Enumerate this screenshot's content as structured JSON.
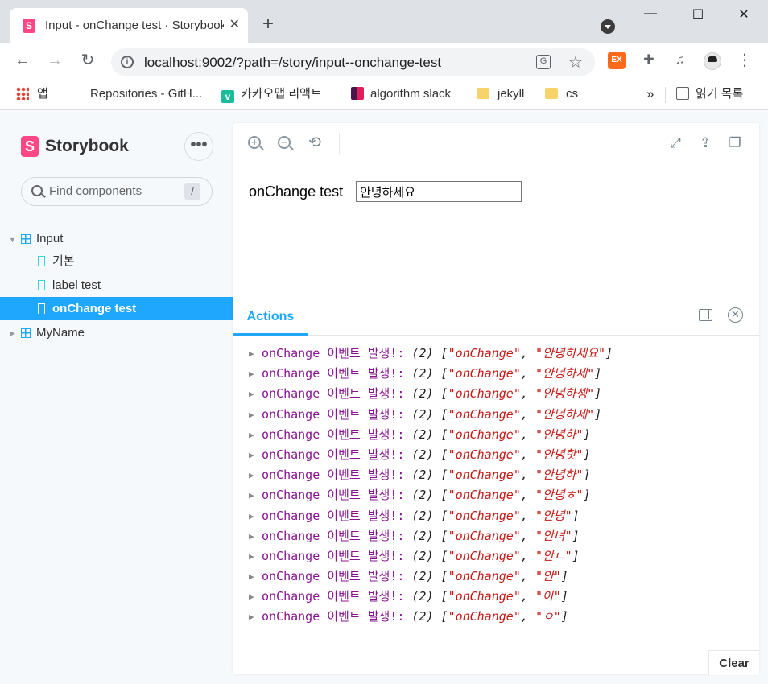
{
  "browser": {
    "tab_title": "Input - onChange test · Storybook",
    "new_tab": "+",
    "tab_close": "✕",
    "window": {
      "minimize": "—",
      "maximize": "☐",
      "close": "✕"
    },
    "url": "localhost:9002/?path=/story/input--onchange-test",
    "bookmarks": [
      {
        "label": "앱"
      },
      {
        "label": "Repositories - GitH..."
      },
      {
        "label": "카카오맵 리액트",
        "icon_letter": "v"
      },
      {
        "label": "algorithm slack"
      },
      {
        "label": "jekyll"
      },
      {
        "label": "cs"
      }
    ],
    "bookmarks_overflow": "»",
    "reading_list": "읽기 목록",
    "ext_badge": "EX"
  },
  "storybook": {
    "brand": "Storybook",
    "brand_logo_letter": "S",
    "menu_glyph": "•••",
    "search_placeholder": "Find components",
    "search_shortcut": "/",
    "tree": [
      {
        "type": "component",
        "label": "Input",
        "expanded": true
      },
      {
        "type": "story",
        "label": "기본"
      },
      {
        "type": "story",
        "label": "label test"
      },
      {
        "type": "story",
        "label": "onChange test",
        "selected": true
      },
      {
        "type": "component",
        "label": "MyName",
        "expanded": false
      }
    ],
    "preview": {
      "label": "onChange test",
      "input_value": "안녕하세요"
    },
    "addons": {
      "active_tab": "Actions",
      "clear_label": "Clear",
      "log_name": "onChange 이벤트 발생!:",
      "log_count": "(2)",
      "log_event": "\"onChange\"",
      "log_values": [
        "안녕하세요",
        "안녕하세",
        "안녕하셍",
        "안녕하세",
        "안녕하",
        "안녕핫",
        "안녕하",
        "안녕ㅎ",
        "안녕",
        "안녀",
        "안ㄴ",
        "안",
        "아",
        "ㅇ"
      ]
    }
  },
  "colors": {
    "accent": "#1ea7fd",
    "brand": "#ff4785",
    "log_name": "#881391",
    "log_string": "#c41a16"
  }
}
